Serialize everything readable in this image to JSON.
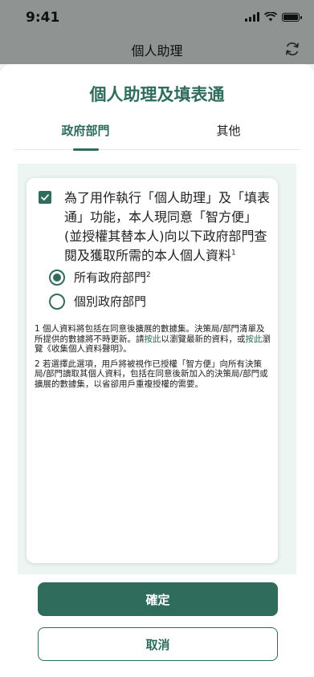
{
  "status_bar": {
    "time": "9:41"
  },
  "app_bar": {
    "title": "個人助理",
    "refresh_icon": "refresh-icon"
  },
  "sheet": {
    "title": "個人助理及填表通",
    "tabs": [
      {
        "label": "政府部門",
        "active": true
      },
      {
        "label": "其他",
        "active": false
      }
    ],
    "consent": {
      "checked": true,
      "text": "為了用作執行「個人助理」及「填表通」功能，本人現同意「智方便」(並授權其替本人)向以下政府部門查閱及獲取所需的本人個人資料",
      "footnote_ref": "1"
    },
    "options": [
      {
        "label": "所有政府部門",
        "footnote_ref": "2",
        "selected": true
      },
      {
        "label": "個別政府部門",
        "selected": false
      }
    ],
    "footnotes": {
      "note1_part1": "1 個人資料將包括在同意後擴展的數據集。決策局/部門清單及所提供的數據將不時更新。請",
      "note1_link1": "按此",
      "note1_part2": "以瀏覽最新的資料，或",
      "note1_link2": "按此",
      "note1_part3": "瀏覽《收集個人資料聲明》。",
      "note2": "2 若選擇此選項，用戶將被視作已授權「智方便」向所有決策局/部門讀取其個人資料，包括在同意後新加入的決策局/部門或擴展的數據集，以省卻用戶重複授權的需要。"
    }
  },
  "buttons": {
    "confirm": "確定",
    "cancel": "取消"
  },
  "colors": {
    "accent": "#2f6c5c",
    "content_bg": "#ecf5f1",
    "dim_overlay": "#8f9392"
  }
}
